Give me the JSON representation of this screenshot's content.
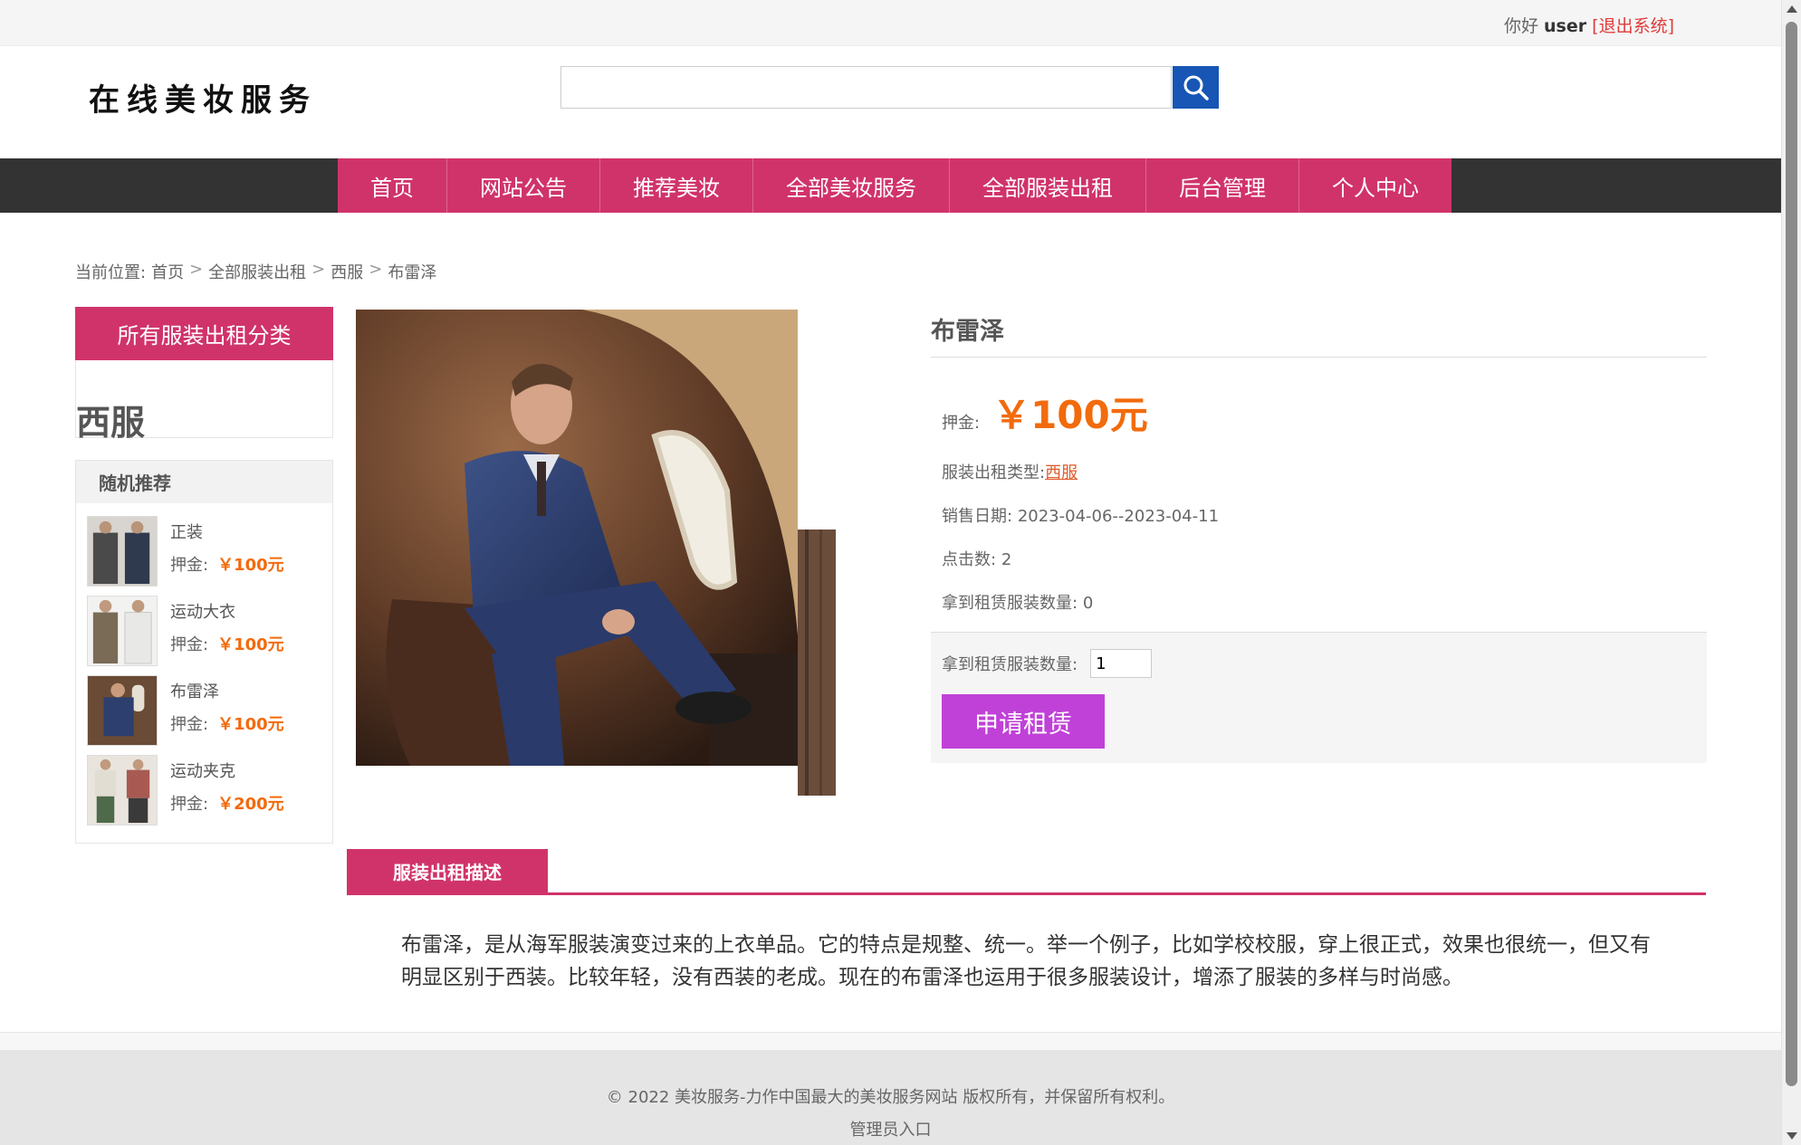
{
  "topbar": {
    "greeting": "你好",
    "username": "user",
    "logout": "[退出系统]"
  },
  "header": {
    "logo": "在线美妆服务",
    "search_placeholder": ""
  },
  "nav": {
    "items": [
      "首页",
      "网站公告",
      "推荐美妆",
      "全部美妆服务",
      "全部服装出租",
      "后台管理",
      "个人中心"
    ]
  },
  "breadcrumb": {
    "prefix": "当前位置:",
    "items": [
      "首页",
      "全部服装出租",
      "西服",
      "布雷泽"
    ],
    "separator": ">"
  },
  "sidebar": {
    "category_title": "所有服装出租分类",
    "current_category": "西服",
    "recommend_title": "随机推荐",
    "price_label": "押金:",
    "items": [
      {
        "name": "正装",
        "price": "￥100元"
      },
      {
        "name": "运动大衣",
        "price": "￥100元"
      },
      {
        "name": "布雷泽",
        "price": "￥100元"
      },
      {
        "name": "运动夹克",
        "price": "￥200元"
      }
    ]
  },
  "product": {
    "title": "布雷泽",
    "price_label": "押金:",
    "price": "￥100元",
    "type_label": "服装出租类型:",
    "type_value": "西服",
    "date_label": "销售日期:",
    "date_value": "2023-04-06--2023-04-11",
    "clicks_label": "点击数:",
    "clicks_value": "2",
    "rented_label": "拿到租赁服装数量:",
    "rented_value": "0",
    "qty_label": "拿到租赁服装数量:",
    "qty_value": "1",
    "rent_button": "申请租赁"
  },
  "description": {
    "tab_label": "服装出租描述",
    "text": "布雷泽，是从海军服装演变过来的上衣单品。它的特点是规整、统一。举一个例子，比如学校校服，穿上很正式，效果也很统一，但又有明显区别于西装。比较年轻，没有西装的老成。现在的布雷泽也运用于很多服装设计，增添了服装的多样与时尚感。"
  },
  "footer": {
    "copyright": "© 2022 美妆服务-力作中国最大的美妆服务网站 版权所有，并保留所有权利。",
    "admin_link": "管理员入口"
  },
  "colors": {
    "accent": "#d0336a",
    "nav_bg": "#333333",
    "price": "#f26b0c",
    "rent_button": "#c041d8",
    "search_button": "#1756b5"
  }
}
